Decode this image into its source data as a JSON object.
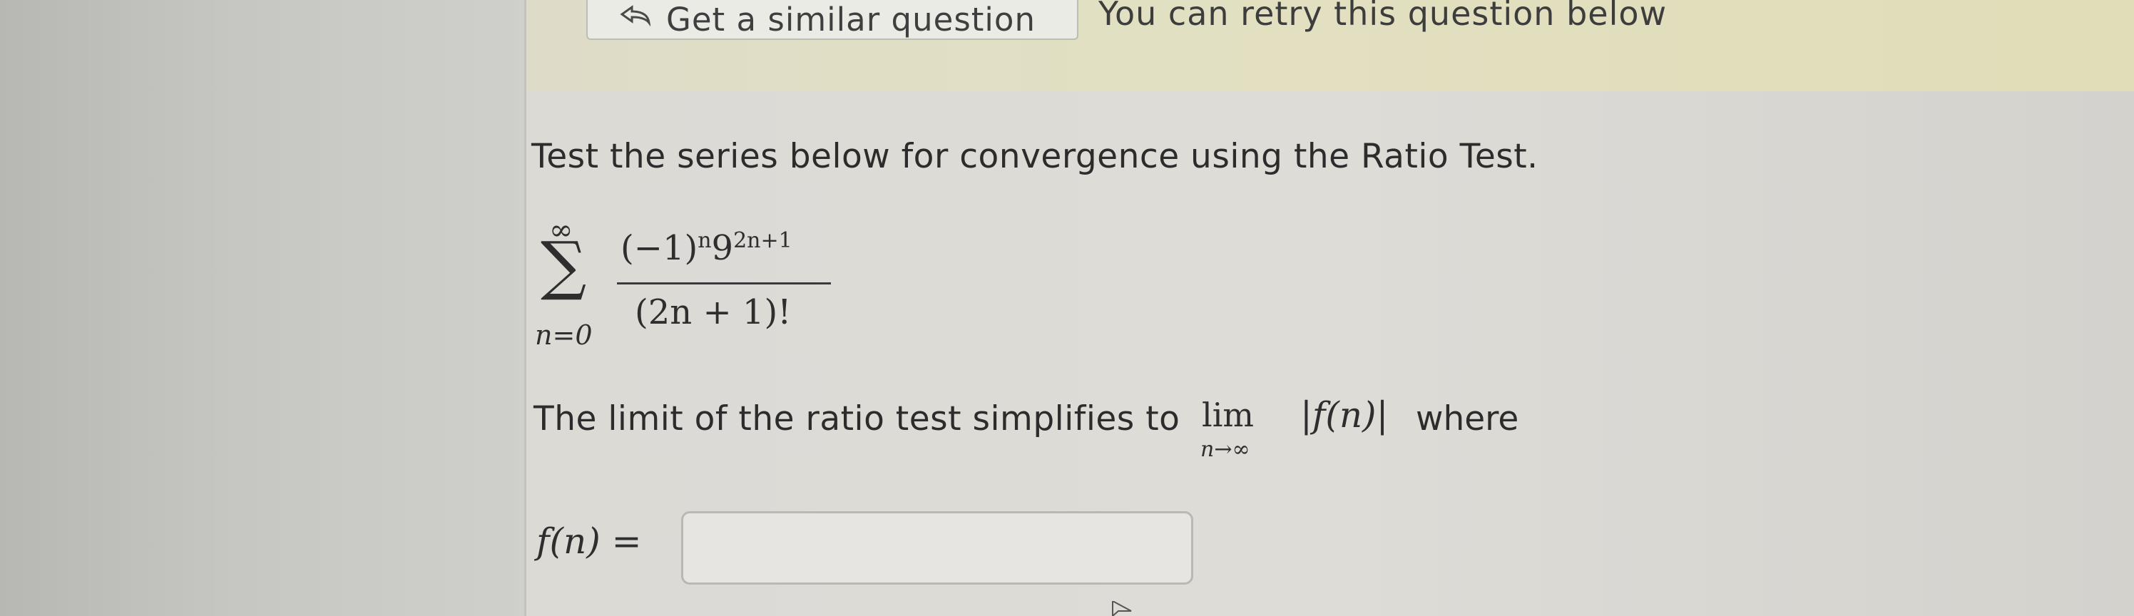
{
  "banner": {
    "similar_button_label": "Get a similar question",
    "retry_text": "You can retry this question below",
    "similar_icon": "undo-arrow-icon"
  },
  "question": {
    "prompt": "Test the series below for convergence using the Ratio Test.",
    "series": {
      "upper_limit": "∞",
      "sum_symbol": "∑",
      "lower_limit": "n=0",
      "numerator_base": "(−1)",
      "numerator_exp1": "n",
      "numerator_mid": "9",
      "numerator_exp2": "2n+1",
      "denominator": "(2n + 1)!"
    },
    "limit_text": "The limit of the ratio test simplifies to",
    "limit_operator": "lim",
    "limit_subscript": "n→∞",
    "limit_abs": "|f(n)|",
    "where_text": "where",
    "answer_label": "f(n) =",
    "answer_value": ""
  },
  "colors": {
    "banner": "#e0ddb8",
    "content": "#dcdad5",
    "text": "#2c2c2c"
  }
}
